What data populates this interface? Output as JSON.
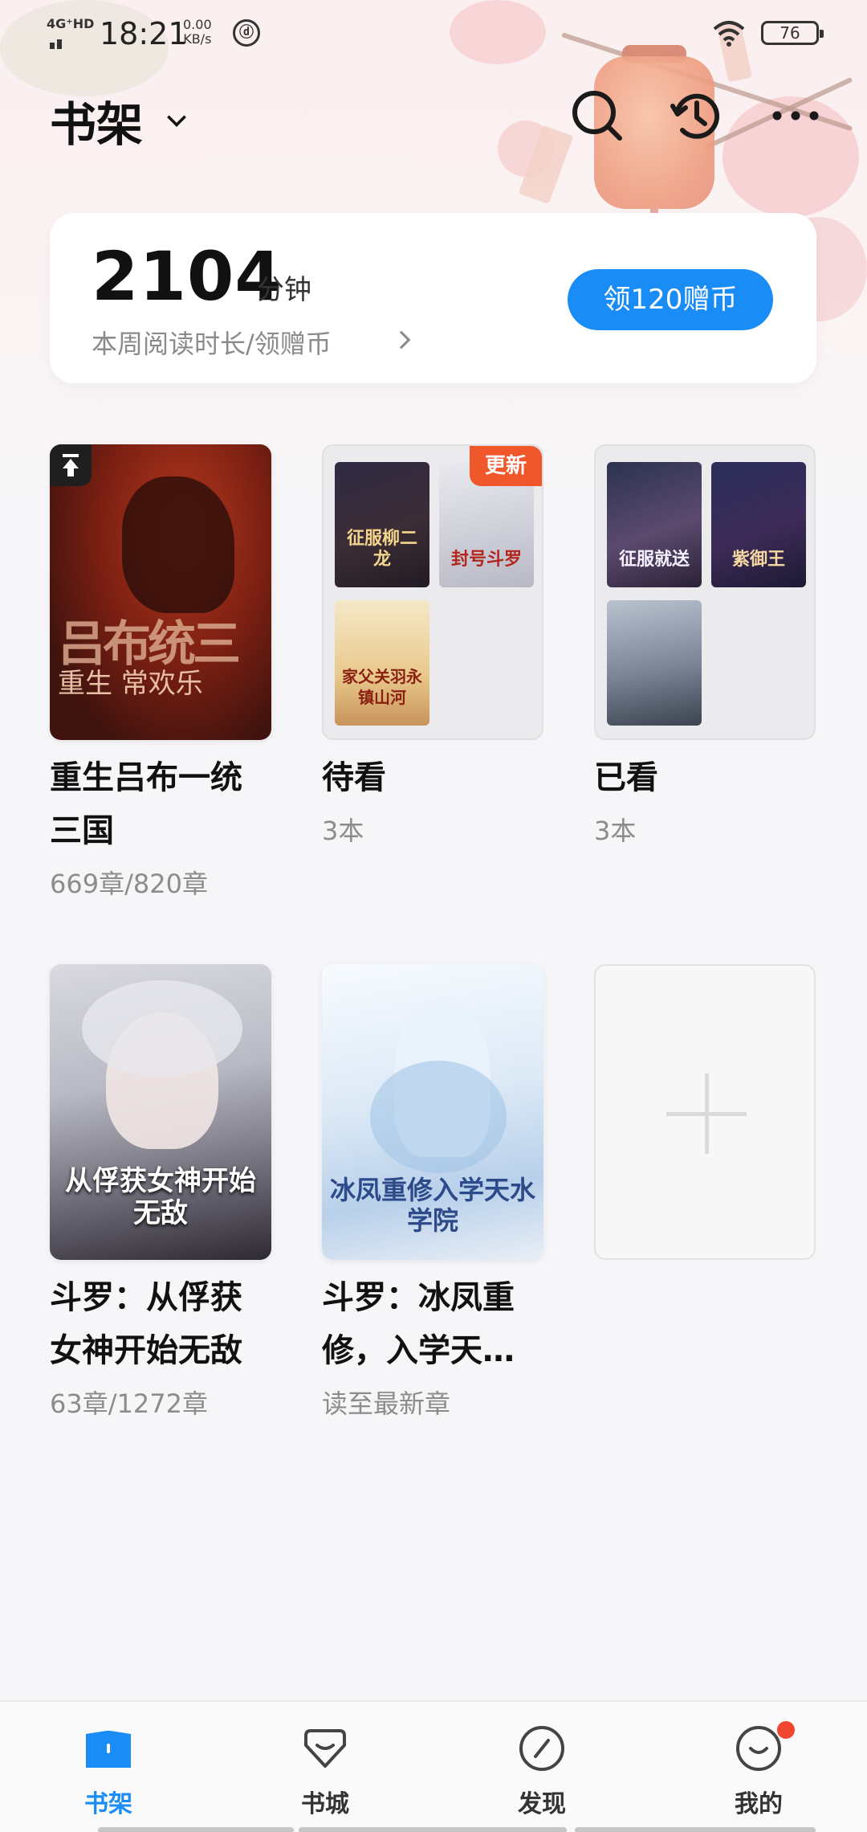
{
  "status_bar": {
    "network": "4G⁺HD",
    "time": "18:21",
    "speed_value": "0.00",
    "speed_unit": "KB/s",
    "battery": "76"
  },
  "header": {
    "title": "书架"
  },
  "reading_card": {
    "minutes": "2104",
    "unit": "分钟",
    "subtitle": "本周阅读时长/领赠币",
    "button": "领120赠币"
  },
  "books": [
    {
      "title": "重生吕布一统三国",
      "meta": "669章/820章",
      "cover_text": "吕布统三",
      "cover_sub": "重生 常欢乐"
    },
    {
      "title": "待看",
      "meta": "3本",
      "badge": "更新",
      "minis": [
        "征服柳二龙",
        "封号斗罗",
        "家父关羽永镇山河"
      ]
    },
    {
      "title": "已看",
      "meta": "3本",
      "minis": [
        "征服就送",
        "紫御王",
        ""
      ]
    },
    {
      "title": "斗罗：从俘获女神开始无敌",
      "meta": "63章/1272章",
      "cover_text": "从俘获女神开始无敌"
    },
    {
      "title": "斗罗：冰凤重修，入学天…",
      "meta": "读至最新章",
      "cover_text": "冰凤重修入学天水学院"
    }
  ],
  "tabs": [
    {
      "label": "书架",
      "icon": "bookshelf-icon",
      "active": true
    },
    {
      "label": "书城",
      "icon": "bookstore-icon"
    },
    {
      "label": "发现",
      "icon": "discover-compass-icon"
    },
    {
      "label": "我的",
      "icon": "profile-face-icon"
    }
  ],
  "colors": {
    "accent": "#1a8cf5",
    "badge": "#f0572a",
    "notification_dot": "#f0452f"
  }
}
